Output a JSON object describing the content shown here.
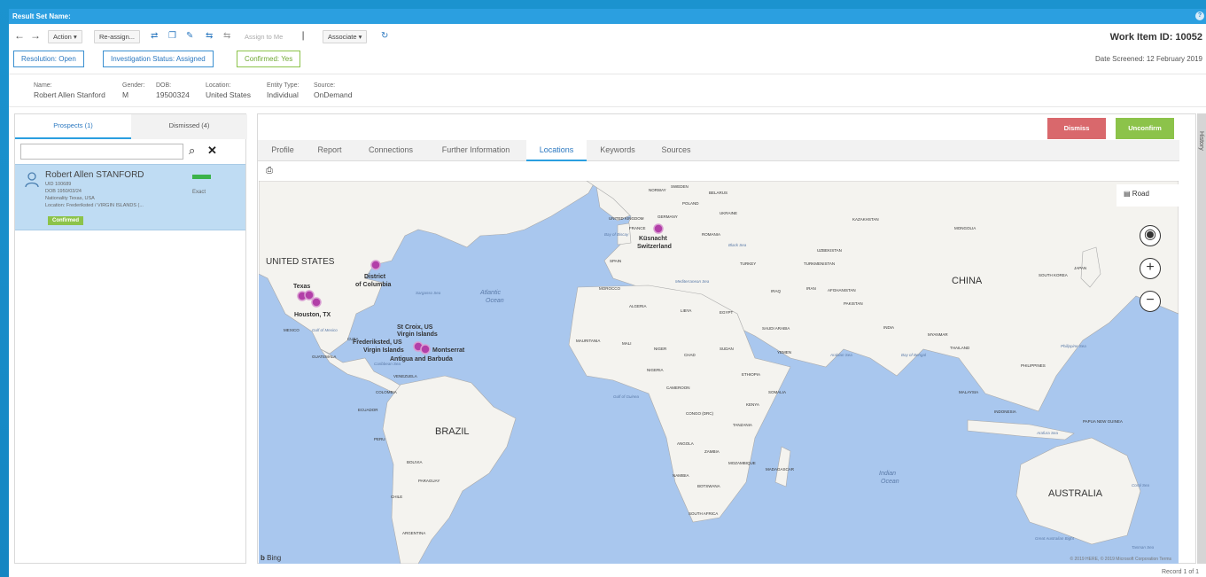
{
  "window": {
    "title": "Result Set Name:",
    "help_glyph": "?"
  },
  "toolbar": {
    "action_label": "Action",
    "reassign_label": "Re-assign...",
    "assign_to_me_label": "Assign to Me",
    "associate_label": "Associate",
    "work_item_id_label": "Work Item ID: 10052"
  },
  "status": {
    "resolution": "Resolution:  Open",
    "investigation": "Investigation Status:  Assigned",
    "confirmed": "Confirmed:  Yes",
    "date_screened": "Date Screened:  12 February 2019"
  },
  "info": {
    "name_label": "Name:",
    "name_value": "Robert Allen Stanford",
    "gender_label": "Gender:",
    "gender_value": "M",
    "dob_label": "DOB:",
    "dob_value": "19500324",
    "location_label": "Location:",
    "location_value": "United States",
    "entity_type_label": "Entity Type:",
    "entity_type_value": "Individual",
    "source_label": "Source:",
    "source_value": "OnDemand"
  },
  "left_panel": {
    "tabs": [
      "Prospects (1)",
      "Dismissed (4)"
    ],
    "search_value": "",
    "result": {
      "name": "Robert Allen STANFORD",
      "uid": "UID 100689",
      "dob": "DOB 1950/03/24",
      "nationality": "Nationality Texas, USA",
      "location": "Location: Frederiksted / VIRGIN ISLANDS (...",
      "match": "Exact",
      "badge": "Confirmed"
    }
  },
  "right_panel": {
    "dismiss_label": "Dismiss",
    "unconfirm_label": "Unconfirm",
    "tabs": [
      "Profile",
      "Report",
      "Connections",
      "Further Information",
      "Locations",
      "Keywords",
      "Sources"
    ],
    "active_tab": "Locations",
    "map": {
      "road_label": "Road",
      "bing_label": "Bing",
      "attribution": "© 2019 HERE, © 2019 Microsoft Corporation  Terms",
      "labels": {
        "united_states": "UNITED STATES",
        "dc_1": "District",
        "dc_2": "of Columbia",
        "texas": "Texas",
        "houston": "Houston, TX",
        "stcroix_1": "St Croix, US",
        "stcroix_2": "Virgin Islands",
        "fred_1": "Frederiksted, US",
        "fred_2": "Virgin Islands",
        "montserrat": "Montserrat",
        "antigua": "Antigua and Barbuda",
        "kussnacht": "Küsnacht",
        "switzerland": "Switzerland",
        "brazil": "BRAZIL",
        "china": "CHINA",
        "australia": "AUSTRALIA",
        "atlantic_1": "Atlantic",
        "atlantic_2": "Ocean",
        "indian_1": "Indian",
        "indian_2": "Ocean",
        "kazakhstan": "KAZAKHSTAN",
        "mongolia": "MONGOLIA",
        "russia_belarus": "BELARUS",
        "poland": "POLAND",
        "ukraine": "UKRAINE",
        "france": "FRANCE",
        "spain": "SPAIN",
        "turkey": "TURKEY",
        "iran": "IRAN",
        "iraq": "IRAQ",
        "pakistan": "PAKISTAN",
        "india": "INDIA",
        "algeria": "ALGERIA",
        "libya": "LIBYA",
        "egypt": "EGYPT",
        "mali": "MALI",
        "niger": "NIGER",
        "chad": "CHAD",
        "sudan": "SUDAN",
        "nigeria": "NIGERIA",
        "saudi": "SAUDI ARABIA",
        "yemen": "YEMEN",
        "ethiopia": "ETHIOPIA",
        "kenya": "KENYA",
        "congo": "CONGO (DRC)",
        "tanzania": "TANZANIA",
        "angola": "ANGOLA",
        "zambia": "ZAMBIA",
        "namibia": "NAMIBIA",
        "botswana": "BOTSWANA",
        "south_africa": "SOUTH AFRICA",
        "madagascar": "MADAGASCAR",
        "mexico": "MEXICO",
        "colombia": "COLOMBIA",
        "venezuela": "VENEZUELA",
        "peru": "PERU",
        "bolivia": "BOLIVIA",
        "argentina": "ARGENTINA",
        "chile": "CHILE",
        "japan": "JAPAN",
        "thailand": "THAILAND",
        "indonesia": "INDONESIA",
        "philippines": "PHILIPPINES",
        "morocco": "MOROCCO",
        "papua": "PAPUA NEW GUINEA",
        "sargasso": "Sargasso Sea",
        "caribbean": "Caribbean Sea",
        "med": "Mediterranean Sea",
        "black": "Black Sea",
        "arabian": "Arabian Sea",
        "bengal": "Bay of Bengal",
        "philsea": "Philippine Sea",
        "arafura": "Arafura Sea",
        "coral": "Coral Sea",
        "tasman": "Tasman Sea",
        "bight": "Great Australian Bight",
        "sweden": "SWEDEN",
        "norway": "NORWAY",
        "uk": "UNITED KINGDOM",
        "germany": "GERMANY",
        "romania": "ROMANIA",
        "afghanistan": "AFGHANISTAN",
        "turkmenistan": "TURKMENISTAN",
        "uzbekistan": "UZBEKISTAN",
        "southkorea": "SOUTH KOREA",
        "mauritania": "MAURITANIA",
        "cameroon": "CAMEROON",
        "somalia": "SOMALIA",
        "mozambique": "MOZAMBIQUE",
        "cuba": "CUBA",
        "guatemala": "GUATEMALA",
        "ecuador": "ECUADOR",
        "paraguay": "PARAGUAY",
        "myanmar": "MYANMAR",
        "malaysia": "MALAYSIA",
        "guinea_gulf": "Gulf of Guinea",
        "bay_biscay": "Bay of Biscay",
        "gulf_mexico": "Gulf of Mexico"
      }
    }
  },
  "footer": {
    "record": "Record 1 of 1"
  },
  "side": {
    "history_label": "History"
  },
  "colors": {
    "accent": "#2b9fe0",
    "dismiss": "#d9686c",
    "unconfirm": "#8cc34a",
    "marker": "#b23fa8",
    "water": "#a9c7ee",
    "land": "#f4f3ef"
  }
}
